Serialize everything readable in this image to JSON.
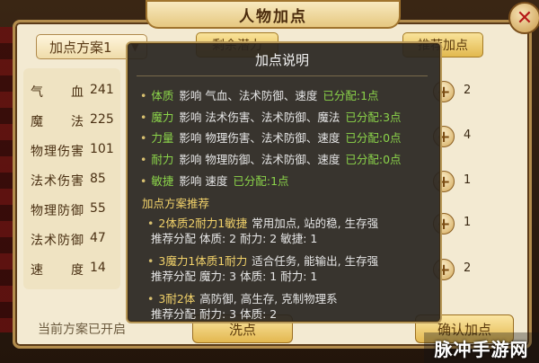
{
  "window": {
    "title": "人物加点",
    "close_symbol": "✕"
  },
  "plan_selector": {
    "selected": "加点方案1"
  },
  "stats": [
    {
      "label": "气　　血",
      "value": "241"
    },
    {
      "label": "魔　　法",
      "value": "225"
    },
    {
      "label": "物理伤害",
      "value": "101"
    },
    {
      "label": "法术伤害",
      "value": "85"
    },
    {
      "label": "物理防御",
      "value": "55"
    },
    {
      "label": "法术防御",
      "value": "47"
    },
    {
      "label": "速　　度",
      "value": "14"
    }
  ],
  "top_tabs": [
    {
      "label": "剩余潜力"
    },
    {
      "label": "推荐加点"
    }
  ],
  "plus_values": [
    "2",
    "4",
    "1",
    "1",
    "2"
  ],
  "status_note": "当前方案已开启",
  "bottom_buttons": {
    "wash": "洗点",
    "confirm": "确认加点"
  },
  "tooltip": {
    "title": "加点说明",
    "attributes": [
      {
        "name": "体质",
        "desc": "影响  气血、法术防御、速度",
        "alloc": "已分配:1点"
      },
      {
        "name": "魔力",
        "desc": "影响  法术伤害、法术防御、魔法",
        "alloc": "已分配:3点"
      },
      {
        "name": "力量",
        "desc": "影响  物理伤害、法术防御、速度",
        "alloc": "已分配:0点"
      },
      {
        "name": "耐力",
        "desc": "影响  物理防御、法术防御、速度",
        "alloc": "已分配:0点"
      },
      {
        "name": "敏捷",
        "desc": "影响  速度",
        "alloc": "已分配:1点"
      }
    ],
    "recommend_heading": "加点方案推荐",
    "plans": [
      {
        "name": "2体质2耐力1敏捷",
        "desc": "常用加点, 站的稳, 生存强",
        "detail": "推荐分配  体质: 2  耐力: 2  敏捷: 1"
      },
      {
        "name": "3魔力1体质1耐力",
        "desc": "适合任务, 能输出, 生存强",
        "detail": "推荐分配  魔力: 3  体质: 1   耐力: 1"
      },
      {
        "name": "3耐2体",
        "desc": "高防御, 高生存, 克制物理系",
        "detail": "推荐分配  耐力: 3  体质: 2"
      }
    ]
  },
  "watermark": "脉冲手游网",
  "colors": {
    "tooltip_bg": "#28241f",
    "attr_green": "#8bd44a",
    "plan_yellow": "#f2d26a",
    "window_bg": "#f3ead2"
  }
}
